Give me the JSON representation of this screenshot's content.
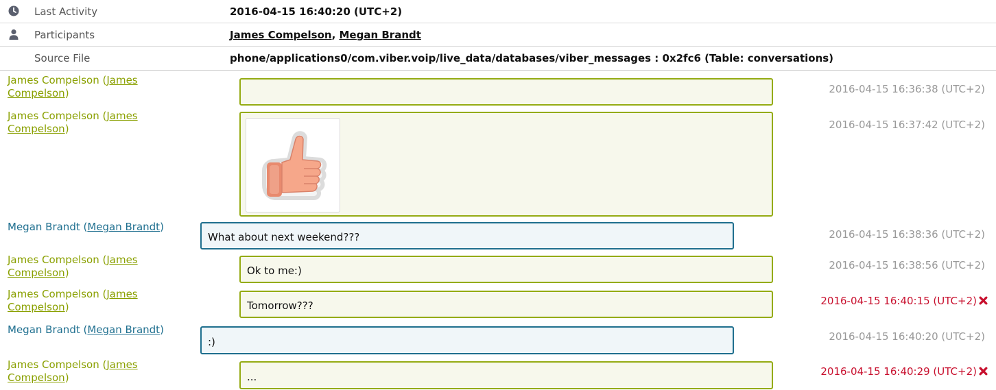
{
  "info": {
    "last_activity": {
      "icon": "clock-icon",
      "label": "Last Activity",
      "value": "2016-04-15 16:40:20 (UTC+2)"
    },
    "participants": {
      "icon": "user-icon",
      "label": "Participants",
      "names": [
        "James Compelson",
        "Megan Brandt"
      ],
      "separator": ", "
    },
    "source_file": {
      "label": "Source File",
      "value": "phone/applications0/com.viber.voip/live_data/databases/viber_messages : 0x2fc6 (Table: conversations)"
    }
  },
  "messages": [
    {
      "sender": "James Compelson",
      "sender_link": "James Compelson",
      "text": "",
      "timestamp": "2016-04-15 16:36:38 (UTC+2)",
      "deleted": false
    },
    {
      "sender": "James Compelson",
      "sender_link": "James Compelson",
      "attachment": "thumbs-up-sticker",
      "timestamp": "2016-04-15 16:37:42 (UTC+2)",
      "deleted": false
    },
    {
      "sender": "Megan Brandt",
      "sender_link": "Megan Brandt",
      "text": "What about next weekend???",
      "timestamp": "2016-04-15 16:38:36 (UTC+2)",
      "deleted": false
    },
    {
      "sender": "James Compelson",
      "sender_link": "James Compelson",
      "text": "Ok to me:)",
      "timestamp": "2016-04-15 16:38:56 (UTC+2)",
      "deleted": false
    },
    {
      "sender": "James Compelson",
      "sender_link": "James Compelson",
      "text": "Tomorrow???",
      "timestamp": "2016-04-15 16:40:15 (UTC+2)",
      "deleted": true
    },
    {
      "sender": "Megan Brandt",
      "sender_link": "Megan Brandt",
      "text": ":)",
      "timestamp": "2016-04-15 16:40:20 (UTC+2)",
      "deleted": false
    },
    {
      "sender": "James Compelson",
      "sender_link": "James Compelson",
      "text": "...",
      "timestamp": "2016-04-15 16:40:29 (UTC+2)",
      "deleted": true
    }
  ],
  "colors": {
    "outgoing": "#94ab12",
    "incoming": "#1f6f8e",
    "deleted": "#c8102e",
    "timestamp": "#999999"
  },
  "icons": {
    "deleted": "close-x-icon",
    "sticker": "thumbs-up-icon"
  }
}
